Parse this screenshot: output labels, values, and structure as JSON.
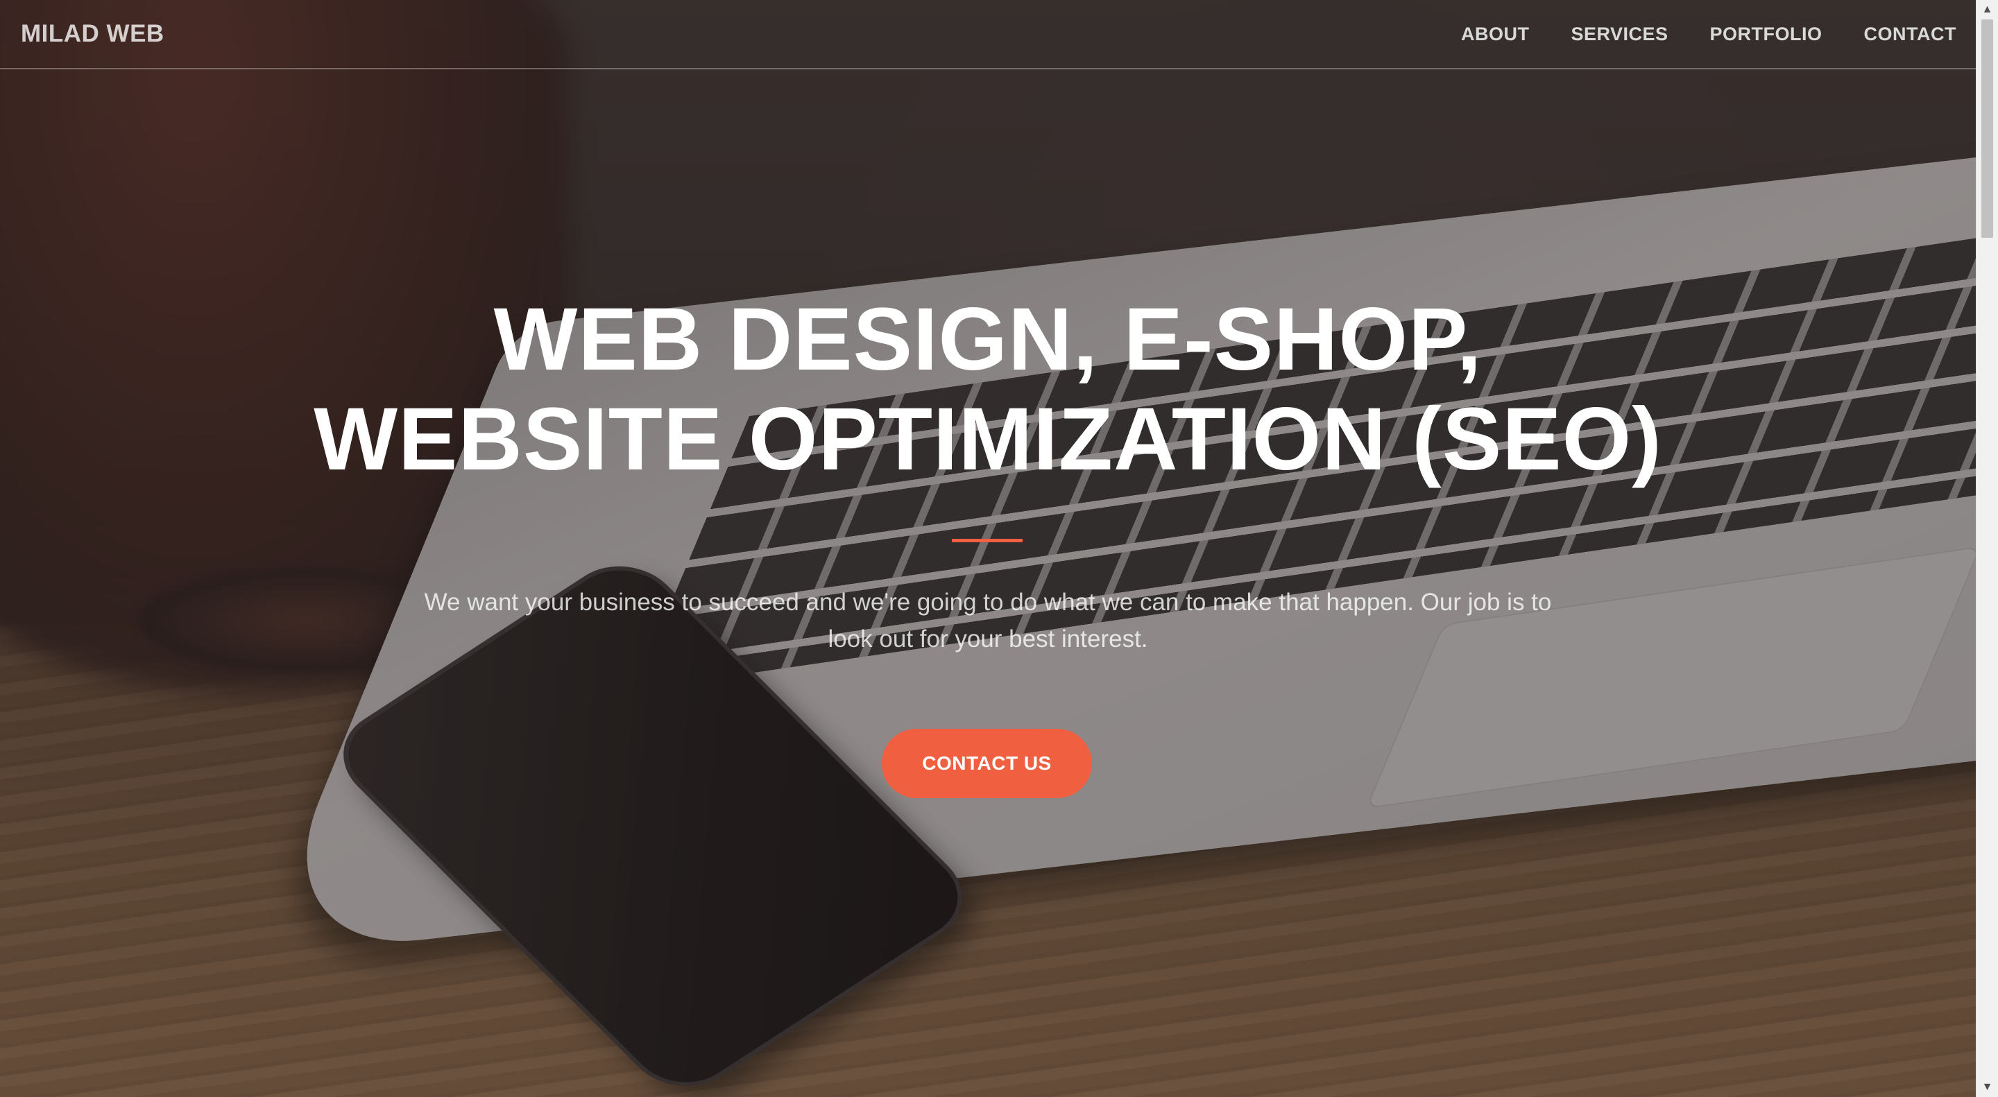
{
  "navbar": {
    "brand": "MILAD WEB",
    "links": [
      "ABOUT",
      "SERVICES",
      "PORTFOLIO",
      "CONTACT"
    ]
  },
  "hero": {
    "title_line1": "WEB DESIGN, E-SHOP,",
    "title_line2": "WEBSITE OPTIMIZATION (SEO)",
    "subtitle": "We want your business to succeed and we're going to do what we can to make that happen. Our job is to look out for your best interest.",
    "cta_label": "CONTACT US"
  },
  "colors": {
    "accent": "#f05f40",
    "overlay": "#322a28",
    "text": "#ffffff"
  },
  "icons": {
    "scroll_up": "triangle-up-icon",
    "scroll_down": "triangle-down-icon"
  },
  "scrollbar": {
    "position": 0
  }
}
